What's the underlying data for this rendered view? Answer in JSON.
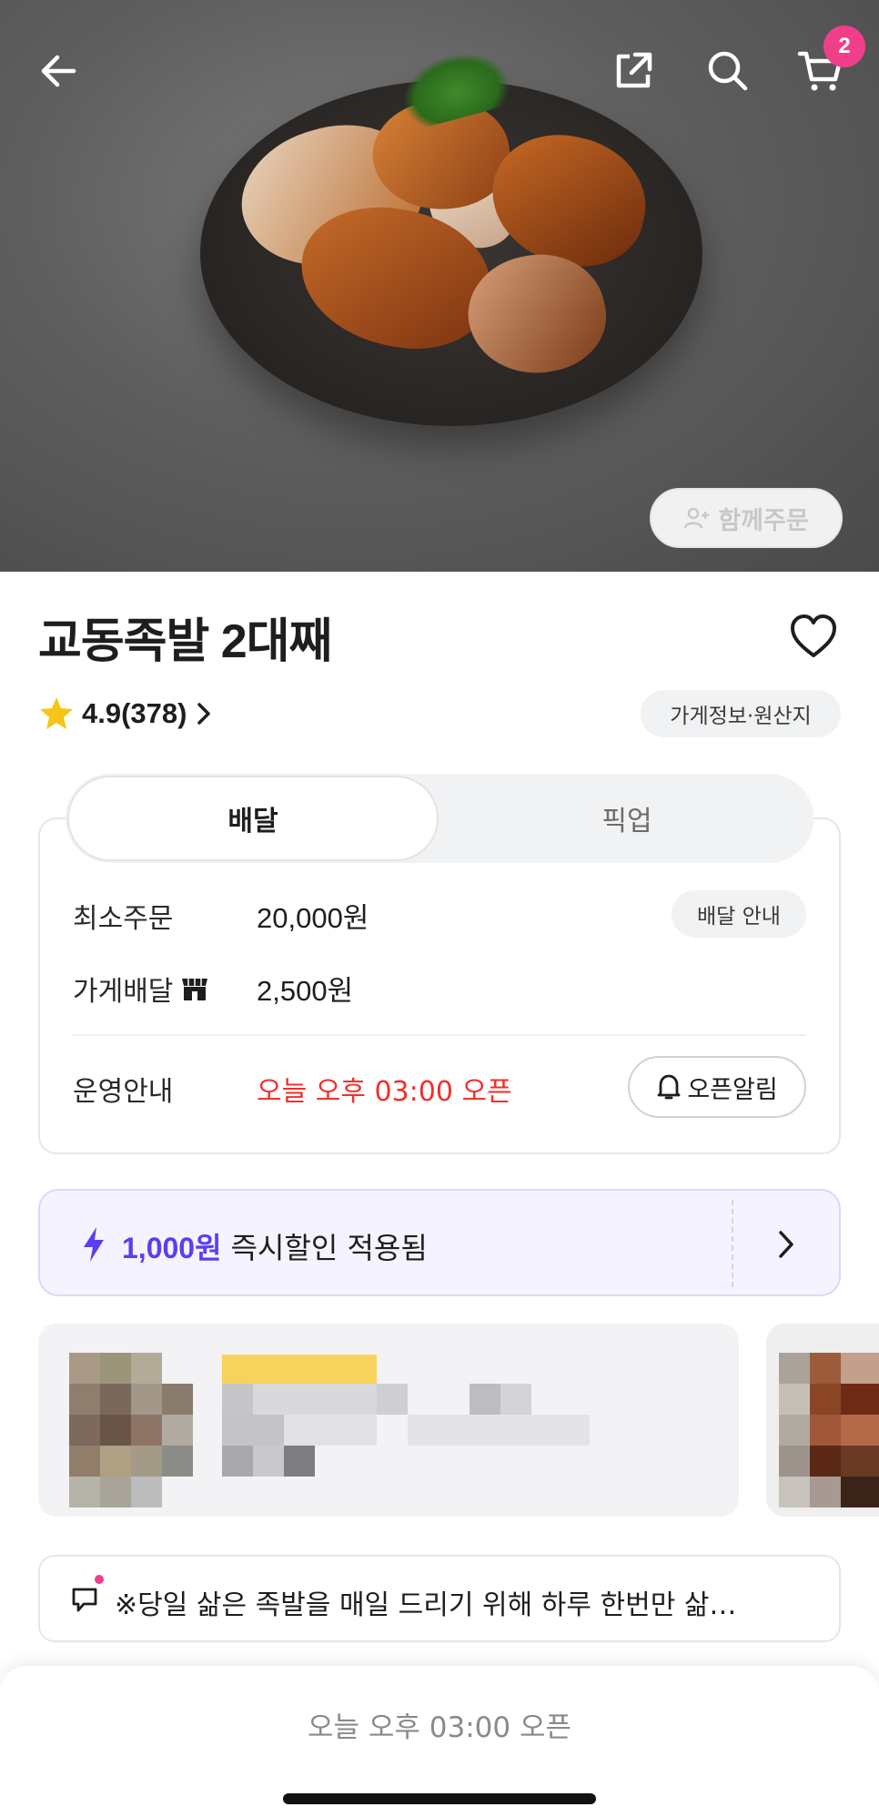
{
  "header": {
    "back_icon": "arrow-left-icon",
    "share_icon": "share-icon",
    "search_icon": "search-icon",
    "cart_icon": "cart-icon",
    "cart_count": "2",
    "group_order_label": "함께주문"
  },
  "store": {
    "name": "교동족발 2대째",
    "rating": "4.9(378)",
    "info_label": "가게정보·원산지"
  },
  "tabs": [
    {
      "label": "배달",
      "active": true
    },
    {
      "label": "픽업",
      "active": false
    }
  ],
  "delivery": {
    "min_order_label": "최소주문",
    "min_order_value": "20,000원",
    "delivery_info_label": "배달 안내",
    "fee_label": "가게배달",
    "fee_value": "2,500원",
    "hours_label": "운영안내",
    "hours_value": "오늘 오후 03:00 오픈",
    "open_alert_label": "오픈알림"
  },
  "discount": {
    "amount": "1,000원",
    "text": "즉시할인 적용됨"
  },
  "notice": {
    "text": "※당일 삶은 족발을 매일 드리기 위해 하루 한번만 삶…"
  },
  "bottom": {
    "status": "오늘 오후 03:00 오픈"
  },
  "colors": {
    "accent_purple": "#5b3ff1",
    "open_red": "#f0302d",
    "badge_pink": "#f03e8a",
    "star_yellow": "#f5c518"
  }
}
